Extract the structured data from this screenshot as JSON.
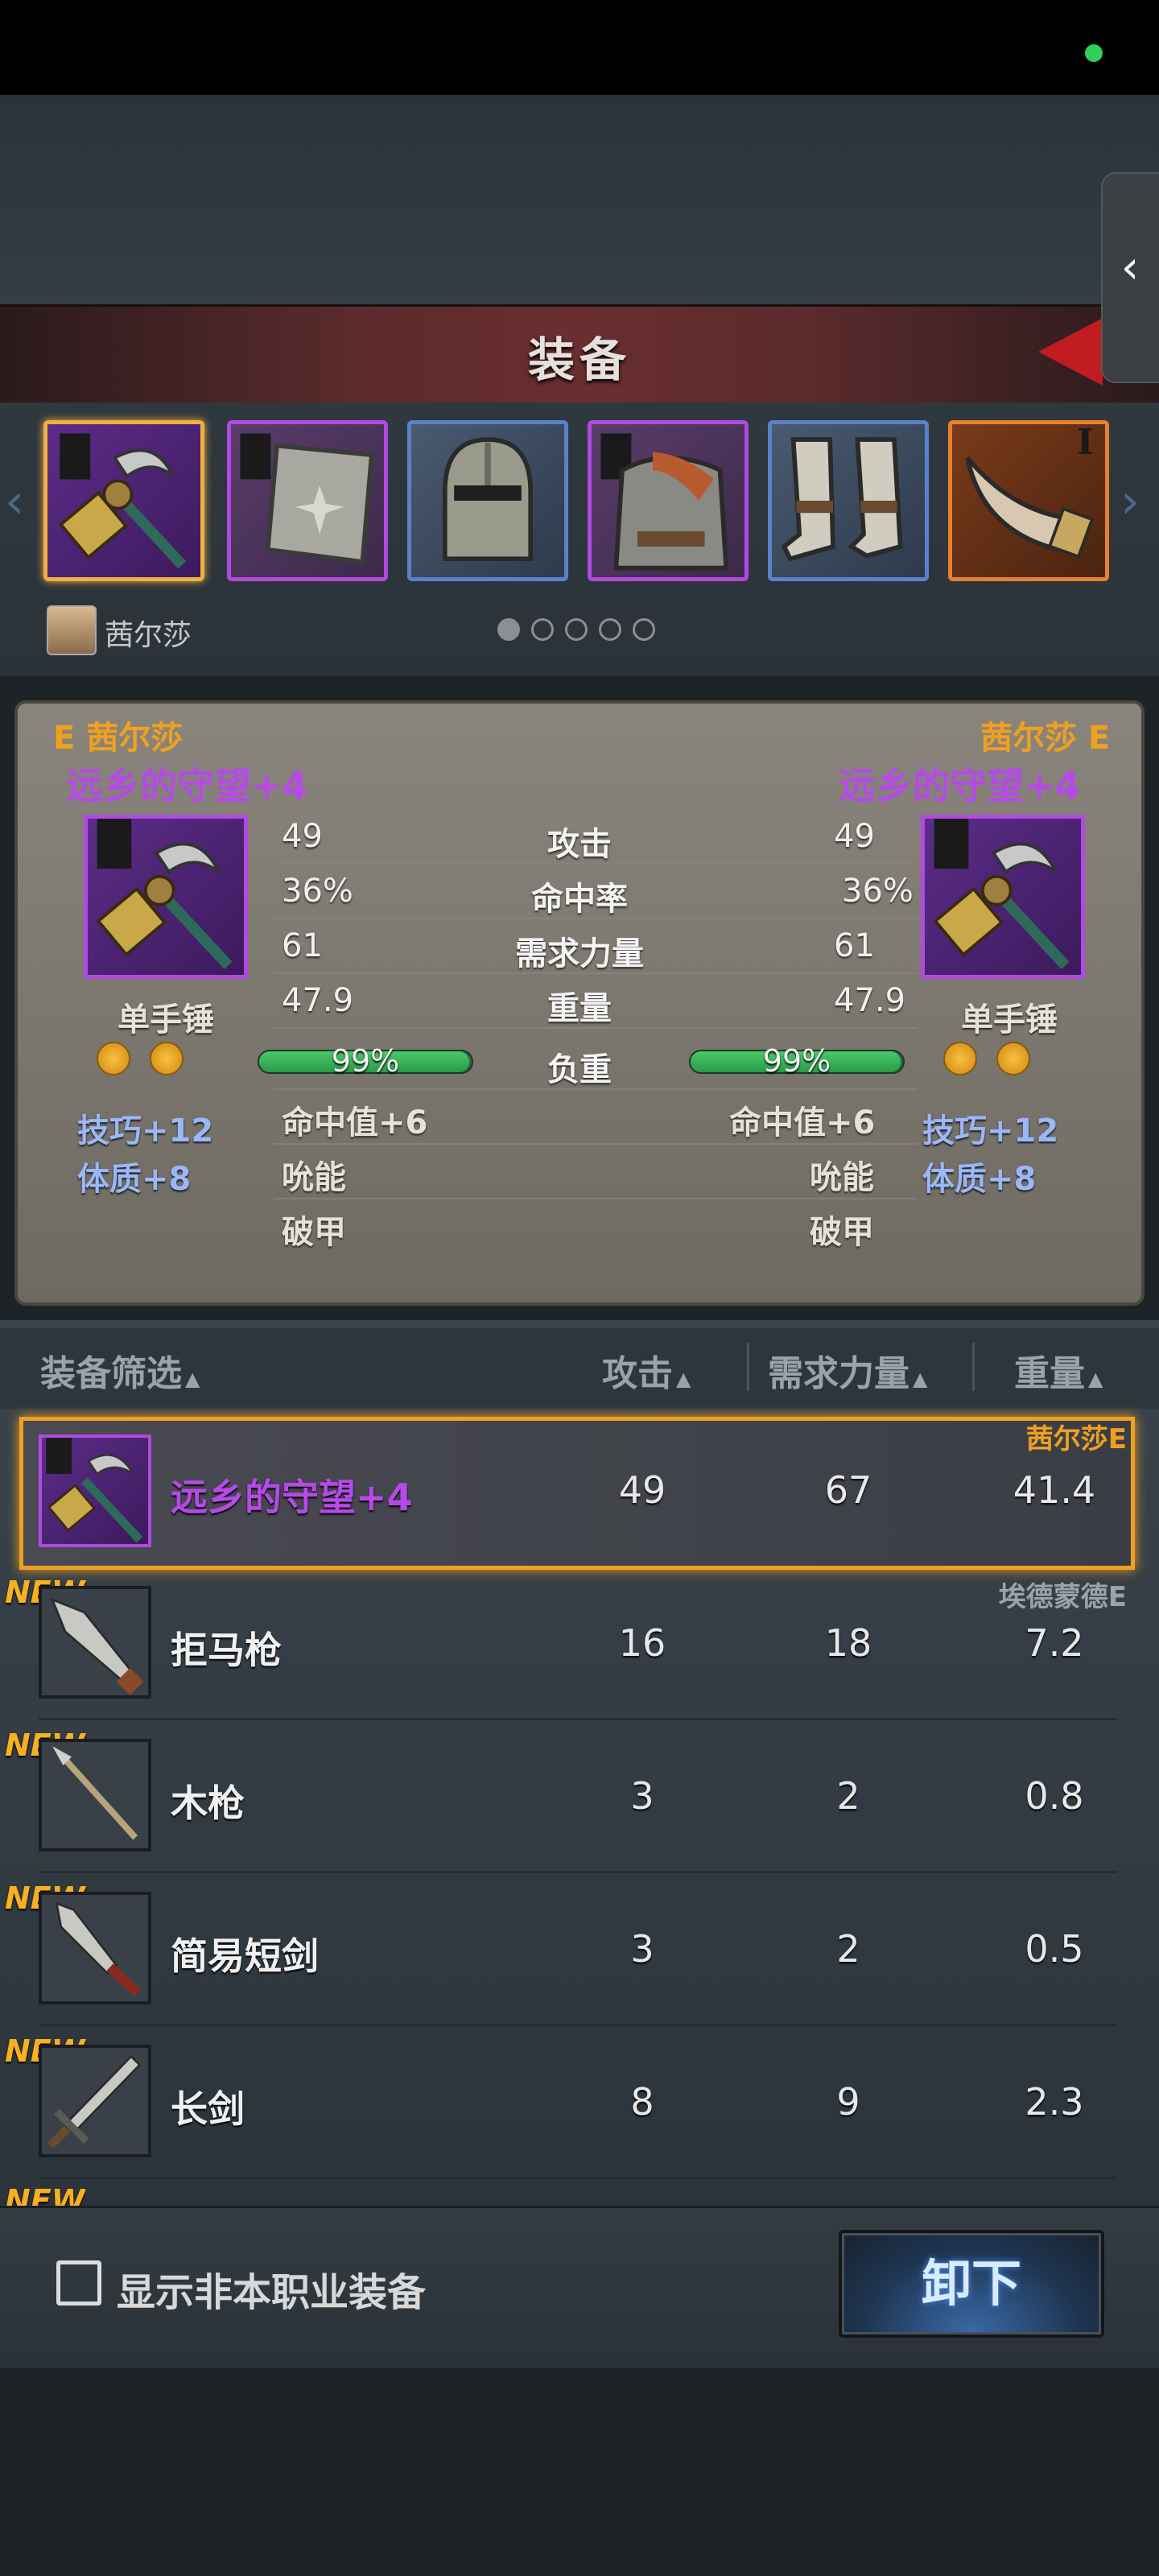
{
  "screen": {
    "title": "装备"
  },
  "slots": [
    {
      "type": "hammer",
      "rarity": "gold"
    },
    {
      "type": "shield",
      "rarity": "purple"
    },
    {
      "type": "helmet",
      "rarity": "blue"
    },
    {
      "type": "armor",
      "rarity": "purple"
    },
    {
      "type": "boots",
      "rarity": "blue"
    },
    {
      "type": "horn",
      "rarity": "orange",
      "badge": "I"
    }
  ],
  "character": {
    "name": "茜尔莎",
    "page_dots": 5,
    "active_dot": 1
  },
  "compare": {
    "left": {
      "owner": "E 茜尔莎",
      "item_name": "远乡的守望+4",
      "item_type": "单手锤",
      "attack": "49",
      "hit_rate": "36%",
      "req_strength": "61",
      "weight": "47.9",
      "load_pct": "99%",
      "load_fraction": 0.99,
      "effect1": "命中值+6",
      "effect2": "吮能",
      "effect3": "破甲",
      "bonus1": "技巧+12",
      "bonus2": "体质+8"
    },
    "right": {
      "owner": "茜尔莎 E",
      "item_name": "远乡的守望+4",
      "item_type": "单手锤",
      "attack": "49",
      "hit_rate": "36%",
      "req_strength": "61",
      "weight": "47.9",
      "load_pct": "99%",
      "load_fraction": 0.99,
      "effect1": "命中值+6",
      "effect2": "吮能",
      "effect3": "破甲",
      "bonus1": "技巧+12",
      "bonus2": "体质+8"
    },
    "labels": {
      "attack": "攻击",
      "hit_rate": "命中率",
      "req_strength": "需求力量",
      "weight": "重量",
      "load": "负重"
    }
  },
  "list": {
    "headers": {
      "filter": "装备筛选",
      "attack": "攻击",
      "req_strength": "需求力量",
      "weight": "重量"
    },
    "items": [
      {
        "name": "远乡的守望+4",
        "attack": "49",
        "req_strength": "67",
        "weight": "41.4",
        "owner": "茜尔莎E",
        "new": "",
        "selected": true
      },
      {
        "name": "拒马枪",
        "attack": "16",
        "req_strength": "18",
        "weight": "7.2",
        "owner": "埃德蒙德E",
        "new": "NEW",
        "selected": false
      },
      {
        "name": "木枪",
        "attack": "3",
        "req_strength": "2",
        "weight": "0.8",
        "owner": "",
        "new": "NEW",
        "selected": false
      },
      {
        "name": "简易短剑",
        "attack": "3",
        "req_strength": "2",
        "weight": "0.5",
        "owner": "",
        "new": "NEW",
        "selected": false
      },
      {
        "name": "长剑",
        "attack": "8",
        "req_strength": "9",
        "weight": "2.3",
        "owner": "",
        "new": "NEW",
        "selected": false
      }
    ],
    "partial_next_tag": "NEW"
  },
  "footer": {
    "checkbox_label": "显示非本职业装备",
    "unequip_label": "卸下"
  },
  "colors": {
    "accent_gold": "#f0a020",
    "rarity_purple": "#b04ae0",
    "rarity_blue": "#5a82c8",
    "status_dot": "#2fd05a"
  }
}
